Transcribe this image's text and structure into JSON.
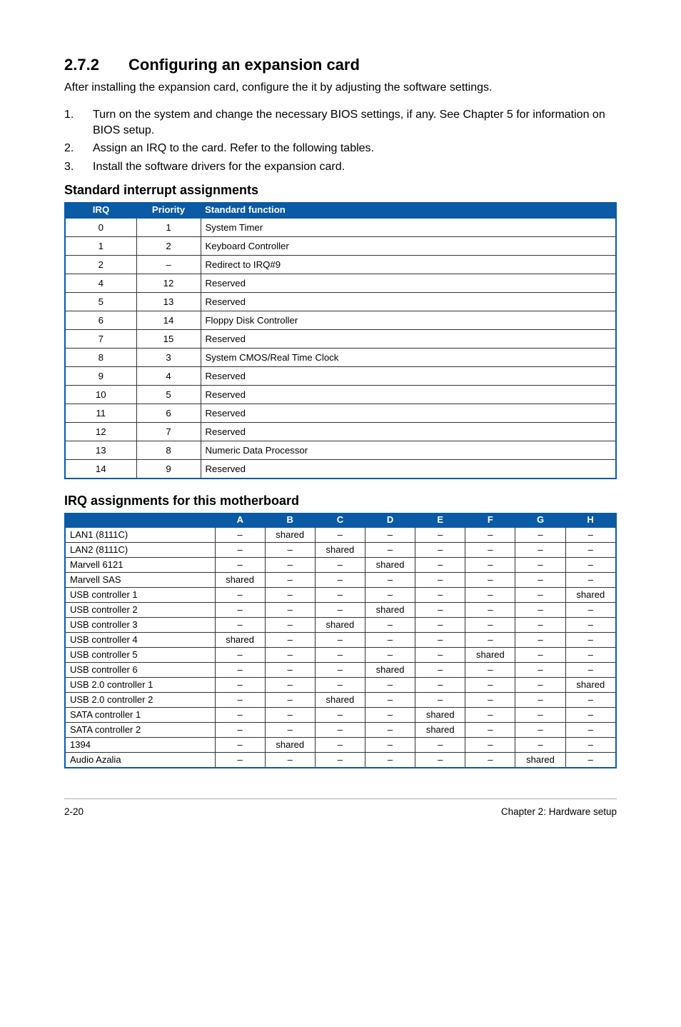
{
  "section": {
    "num": "2.7.2",
    "title": "Configuring an expansion card"
  },
  "intro": "After installing the expansion card, configure the it by adjusting the software settings.",
  "steps": [
    {
      "n": "1.",
      "t": "Turn on the system and change the necessary BIOS settings, if any. See Chapter 5 for information on BIOS setup."
    },
    {
      "n": "2.",
      "t": "Assign an IRQ to the card. Refer to the following tables."
    },
    {
      "n": "3.",
      "t": "Install the software drivers for the expansion card."
    }
  ],
  "table1_heading": "Standard interrupt assignments",
  "table1_headers": {
    "irq": "IRQ",
    "priority": "Priority",
    "fn": "Standard function"
  },
  "table1_rows": [
    {
      "irq": "0",
      "pri": "1",
      "fn": "System Timer"
    },
    {
      "irq": "1",
      "pri": "2",
      "fn": "Keyboard Controller"
    },
    {
      "irq": "2",
      "pri": "–",
      "fn": "Redirect to IRQ#9"
    },
    {
      "irq": "4",
      "pri": "12",
      "fn": "Reserved"
    },
    {
      "irq": "5",
      "pri": "13",
      "fn": "Reserved"
    },
    {
      "irq": "6",
      "pri": "14",
      "fn": "Floppy Disk Controller"
    },
    {
      "irq": "7",
      "pri": "15",
      "fn": "Reserved"
    },
    {
      "irq": "8",
      "pri": "3",
      "fn": "System CMOS/Real Time Clock"
    },
    {
      "irq": "9",
      "pri": "4",
      "fn": "Reserved"
    },
    {
      "irq": "10",
      "pri": "5",
      "fn": "Reserved"
    },
    {
      "irq": "11",
      "pri": "6",
      "fn": "Reserved"
    },
    {
      "irq": "12",
      "pri": "7",
      "fn": "Reserved"
    },
    {
      "irq": "13",
      "pri": "8",
      "fn": "Numeric Data Processor"
    },
    {
      "irq": "14",
      "pri": "9",
      "fn": "Reserved"
    }
  ],
  "table2_heading": "IRQ assignments for this motherboard",
  "table2_headers": [
    "",
    "A",
    "B",
    "C",
    "D",
    "E",
    "F",
    "G",
    "H"
  ],
  "table2_rows": [
    {
      "dev": "LAN1 (8111C)",
      "c": [
        "–",
        "shared",
        "–",
        "–",
        "–",
        "–",
        "–",
        "–"
      ]
    },
    {
      "dev": "LAN2 (8111C)",
      "c": [
        "–",
        "–",
        "shared",
        "–",
        "–",
        "–",
        "–",
        "–"
      ]
    },
    {
      "dev": "Marvell 6121",
      "c": [
        "–",
        "–",
        "–",
        "shared",
        "–",
        "–",
        "–",
        "–"
      ]
    },
    {
      "dev": "Marvell SAS",
      "c": [
        "shared",
        "–",
        "–",
        "–",
        "–",
        "–",
        "–",
        "–"
      ]
    },
    {
      "dev": "USB controller 1",
      "c": [
        "–",
        "–",
        "–",
        "–",
        "–",
        "–",
        "–",
        "shared"
      ]
    },
    {
      "dev": "USB controller 2",
      "c": [
        "–",
        "–",
        "–",
        "shared",
        "–",
        "–",
        "–",
        "–"
      ]
    },
    {
      "dev": "USB controller 3",
      "c": [
        "–",
        "–",
        "shared",
        "–",
        "–",
        "–",
        "–",
        "–"
      ]
    },
    {
      "dev": "USB controller 4",
      "c": [
        "shared",
        "–",
        "–",
        "–",
        "–",
        "–",
        "–",
        "–"
      ]
    },
    {
      "dev": "USB controller 5",
      "c": [
        "–",
        "–",
        "–",
        "–",
        "–",
        "shared",
        "–",
        "–"
      ]
    },
    {
      "dev": "USB controller 6",
      "c": [
        "–",
        "–",
        "–",
        "shared",
        "–",
        "–",
        "–",
        "–"
      ]
    },
    {
      "dev": "USB 2.0 controller 1",
      "c": [
        "–",
        "–",
        "–",
        "–",
        "–",
        "–",
        "–",
        "shared"
      ]
    },
    {
      "dev": "USB 2.0 controller 2",
      "c": [
        "–",
        "–",
        "shared",
        "–",
        "–",
        "–",
        "–",
        "–"
      ]
    },
    {
      "dev": "SATA controller 1",
      "c": [
        "–",
        "–",
        "–",
        "–",
        "shared",
        "–",
        "–",
        "–"
      ]
    },
    {
      "dev": "SATA controller 2",
      "c": [
        "–",
        "–",
        "–",
        "–",
        "shared",
        "–",
        "–",
        "–"
      ]
    },
    {
      "dev": "1394",
      "c": [
        "–",
        "shared",
        "–",
        "–",
        "–",
        "–",
        "–",
        "–"
      ]
    },
    {
      "dev": "Audio Azalia",
      "c": [
        "–",
        "–",
        "–",
        "–",
        "–",
        "–",
        "shared",
        "–"
      ]
    }
  ],
  "footer": {
    "left": "2-20",
    "right": "Chapter 2:  Hardware setup"
  }
}
